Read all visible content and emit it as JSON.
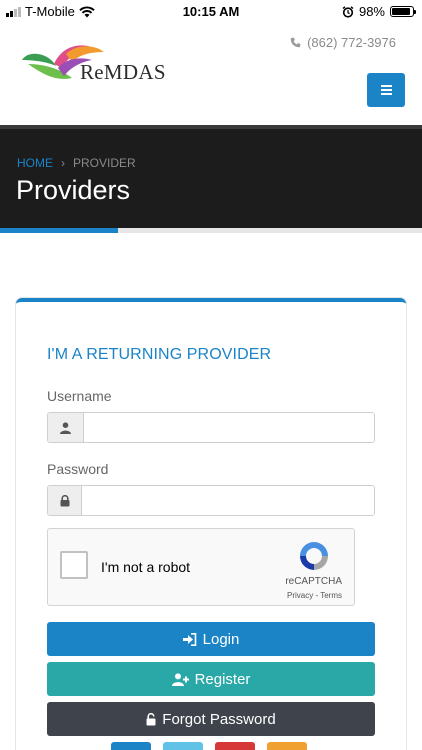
{
  "status_bar": {
    "carrier": "T-Mobile",
    "time": "10:15 AM",
    "battery": "98%"
  },
  "header": {
    "logo_text": "ReMDAS",
    "phone": "(862) 772-3976"
  },
  "breadcrumb": {
    "home": "HOME",
    "separator": "›",
    "current": "PROVIDER"
  },
  "page": {
    "title": "Providers"
  },
  "login_form": {
    "heading": "I'M A RETURNING PROVIDER",
    "username_label": "Username",
    "username_value": "",
    "password_label": "Password",
    "password_value": "",
    "recaptcha_label": "I'm not a robot",
    "recaptcha_brand": "reCAPTCHA",
    "recaptcha_links": "Privacy - Terms",
    "login_label": "Login",
    "register_label": "Register",
    "forgot_label": "Forgot Password"
  },
  "social": [
    "facebook",
    "twitter",
    "pinterest",
    "rss"
  ],
  "colors": {
    "accent": "#1a84c7",
    "register": "#2aa7a7",
    "forgot": "#3e434c",
    "hero_bg": "#1c1c1c",
    "facebook": "#1a84c7",
    "twitter": "#5fc2e6",
    "pinterest": "#d63737",
    "rss": "#f0a030"
  }
}
